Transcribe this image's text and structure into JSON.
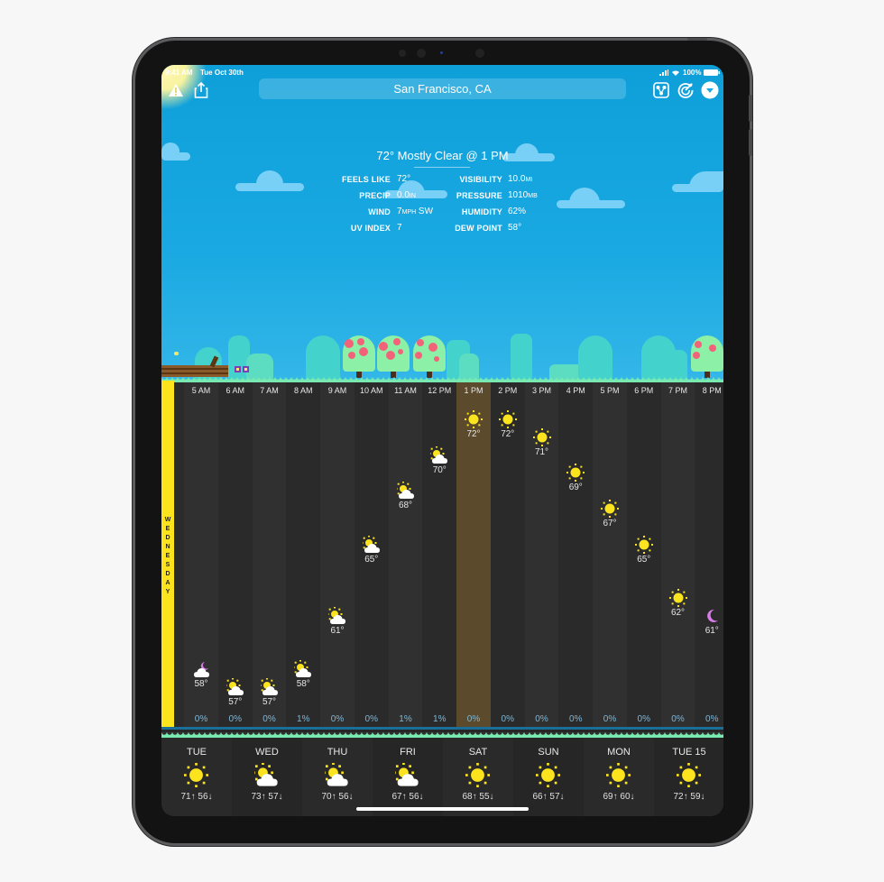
{
  "status_bar": {
    "time": "9:41 AM",
    "date": "Tue Oct 30th",
    "battery": "100%"
  },
  "toolbar": {
    "left_icons": [
      "warning-icon",
      "share-icon"
    ],
    "location": "San Francisco, CA",
    "right_icons": [
      "layers-icon",
      "radar-icon",
      "dropdown-icon"
    ]
  },
  "current": {
    "title": "72° Mostly Clear @ 1 PM",
    "left": [
      {
        "label": "FEELS LIKE",
        "value": "72°",
        "unit": ""
      },
      {
        "label": "PRECIP",
        "value": "0.0",
        "unit": "IN"
      },
      {
        "label": "WIND",
        "value": "7",
        "unit": "MPH",
        "suffix": " SW"
      },
      {
        "label": "UV INDEX",
        "value": "7",
        "unit": ""
      }
    ],
    "right": [
      {
        "label": "VISIBILITY",
        "value": "10.0",
        "unit": "MI"
      },
      {
        "label": "PRESSURE",
        "value": "1010",
        "unit": "MB"
      },
      {
        "label": "HUMIDITY",
        "value": "62%",
        "unit": ""
      },
      {
        "label": "DEW POINT",
        "value": "58°",
        "unit": ""
      }
    ]
  },
  "day_label": "WEDNESDAY",
  "selected_hour": "1 PM",
  "colors": {
    "sky": "#1aa9e2",
    "selected": "#5c4a2c",
    "day_bar": "#fbe41e",
    "precip": "#7fb7d6",
    "sun": "#fbe41e",
    "moon": "#d97be8"
  },
  "hourly": [
    {
      "hour": "5 AM",
      "temp": "58°",
      "temp_value": 58,
      "icon": "cloudy-night-icon",
      "precip": "0%"
    },
    {
      "hour": "6 AM",
      "temp": "57°",
      "temp_value": 57,
      "icon": "partly-cloudy-icon",
      "precip": "0%"
    },
    {
      "hour": "7 AM",
      "temp": "57°",
      "temp_value": 57,
      "icon": "partly-cloudy-icon",
      "precip": "0%"
    },
    {
      "hour": "8 AM",
      "temp": "58°",
      "temp_value": 58,
      "icon": "partly-cloudy-icon",
      "precip": "1%"
    },
    {
      "hour": "9 AM",
      "temp": "61°",
      "temp_value": 61,
      "icon": "partly-cloudy-icon",
      "precip": "0%"
    },
    {
      "hour": "10 AM",
      "temp": "65°",
      "temp_value": 65,
      "icon": "partly-cloudy-icon",
      "precip": "0%"
    },
    {
      "hour": "11 AM",
      "temp": "68°",
      "temp_value": 68,
      "icon": "partly-cloudy-icon",
      "precip": "1%"
    },
    {
      "hour": "12 PM",
      "temp": "70°",
      "temp_value": 70,
      "icon": "partly-cloudy-icon",
      "precip": "1%"
    },
    {
      "hour": "1 PM",
      "temp": "72°",
      "temp_value": 72,
      "icon": "sun-icon",
      "precip": "0%"
    },
    {
      "hour": "2 PM",
      "temp": "72°",
      "temp_value": 72,
      "icon": "sun-icon",
      "precip": "0%"
    },
    {
      "hour": "3 PM",
      "temp": "71°",
      "temp_value": 71,
      "icon": "sun-icon",
      "precip": "0%"
    },
    {
      "hour": "4 PM",
      "temp": "69°",
      "temp_value": 69,
      "icon": "sun-icon",
      "precip": "0%"
    },
    {
      "hour": "5 PM",
      "temp": "67°",
      "temp_value": 67,
      "icon": "sun-icon",
      "precip": "0%"
    },
    {
      "hour": "6 PM",
      "temp": "65°",
      "temp_value": 65,
      "icon": "sun-icon",
      "precip": "0%"
    },
    {
      "hour": "7 PM",
      "temp": "62°",
      "temp_value": 62,
      "icon": "sun-icon",
      "precip": "0%"
    },
    {
      "hour": "8 PM",
      "temp": "61°",
      "temp_value": 61,
      "icon": "moon-icon",
      "precip": "0%"
    }
  ],
  "daily": [
    {
      "day": "TUE",
      "icon": "sun-icon",
      "high": "71",
      "low": "56"
    },
    {
      "day": "WED",
      "icon": "partly-cloudy-icon",
      "high": "73",
      "low": "57"
    },
    {
      "day": "THU",
      "icon": "partly-cloudy-icon",
      "high": "70",
      "low": "56"
    },
    {
      "day": "FRI",
      "icon": "partly-cloudy-icon",
      "high": "67",
      "low": "56"
    },
    {
      "day": "SAT",
      "icon": "sun-icon",
      "high": "68",
      "low": "55"
    },
    {
      "day": "SUN",
      "icon": "sun-icon",
      "high": "66",
      "low": "57"
    },
    {
      "day": "MON",
      "icon": "sun-icon",
      "high": "69",
      "low": "60"
    },
    {
      "day": "TUE 15",
      "icon": "sun-icon",
      "high": "72",
      "low": "59"
    }
  ],
  "arrows": {
    "up": "↑",
    "down": "↓"
  }
}
